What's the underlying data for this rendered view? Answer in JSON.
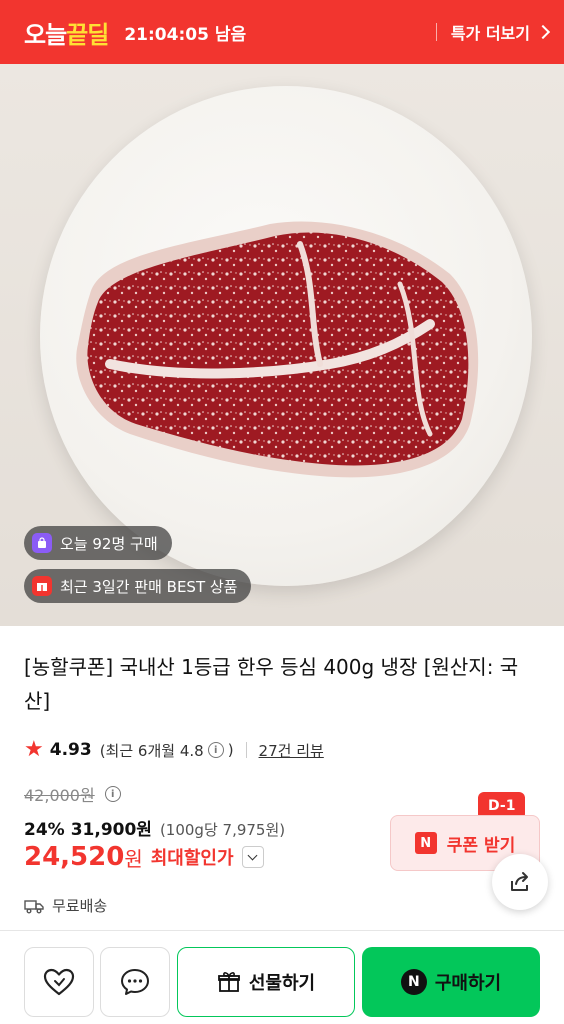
{
  "deal_bar": {
    "logo_part1": "오늘",
    "logo_part2": "끝딜",
    "countdown": "21:04:05 남음",
    "more_label": "특가 더보기"
  },
  "photo": {
    "badges": [
      {
        "icon": "shopping-bag-icon",
        "label": "오늘 92명 구매"
      },
      {
        "icon": "gift-box-icon",
        "label": "최근 3일간 판매 BEST 상품"
      }
    ]
  },
  "product": {
    "title": "[농할쿠폰] 국내산 1등급 한우 등심 400g 냉장 [원산지: 국산]",
    "rating": "4.93",
    "rating_recent": "(최근 6개월 4.8",
    "rating_recent_close": ")",
    "info_glyph": "i",
    "review_link": "27건 리뷰",
    "original_price": "42,000원",
    "discount_rate": "24%",
    "sale_price": "31,900원",
    "unit_price": "(100g당 7,975원)",
    "max_price": "24,520",
    "max_price_won": "원",
    "max_label": "최대할인가",
    "shipping": "무료배송"
  },
  "coupon": {
    "dday": "D-1",
    "n_mark": "N",
    "label": "쿠폰 받기"
  },
  "bottom_bar": {
    "gift_label": "선물하기",
    "buy_n_mark": "N",
    "buy_label": "구매하기"
  },
  "colors": {
    "brand_red": "#f2352f",
    "naver_green": "#03c75a",
    "highlight_yellow": "#ffe034"
  }
}
